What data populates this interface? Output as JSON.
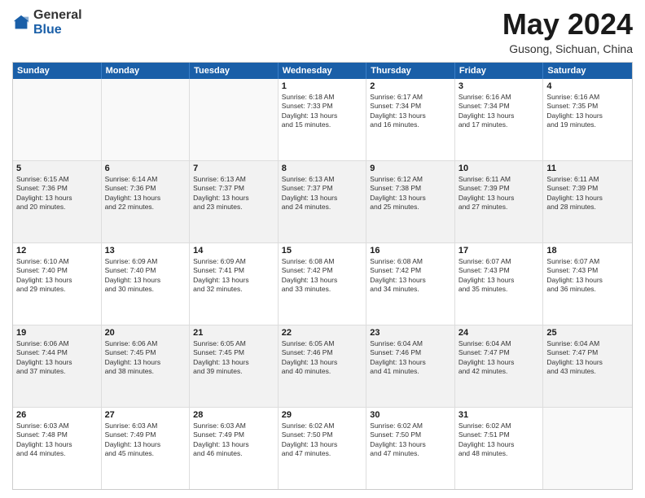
{
  "logo": {
    "text_general": "General",
    "text_blue": "Blue"
  },
  "title": "May 2024",
  "subtitle": "Gusong, Sichuan, China",
  "days_of_week": [
    "Sunday",
    "Monday",
    "Tuesday",
    "Wednesday",
    "Thursday",
    "Friday",
    "Saturday"
  ],
  "rows": [
    {
      "alt": false,
      "cells": [
        {
          "day": "",
          "info": ""
        },
        {
          "day": "",
          "info": ""
        },
        {
          "day": "",
          "info": ""
        },
        {
          "day": "1",
          "info": "Sunrise: 6:18 AM\nSunset: 7:33 PM\nDaylight: 13 hours\nand 15 minutes."
        },
        {
          "day": "2",
          "info": "Sunrise: 6:17 AM\nSunset: 7:34 PM\nDaylight: 13 hours\nand 16 minutes."
        },
        {
          "day": "3",
          "info": "Sunrise: 6:16 AM\nSunset: 7:34 PM\nDaylight: 13 hours\nand 17 minutes."
        },
        {
          "day": "4",
          "info": "Sunrise: 6:16 AM\nSunset: 7:35 PM\nDaylight: 13 hours\nand 19 minutes."
        }
      ]
    },
    {
      "alt": true,
      "cells": [
        {
          "day": "5",
          "info": "Sunrise: 6:15 AM\nSunset: 7:36 PM\nDaylight: 13 hours\nand 20 minutes."
        },
        {
          "day": "6",
          "info": "Sunrise: 6:14 AM\nSunset: 7:36 PM\nDaylight: 13 hours\nand 22 minutes."
        },
        {
          "day": "7",
          "info": "Sunrise: 6:13 AM\nSunset: 7:37 PM\nDaylight: 13 hours\nand 23 minutes."
        },
        {
          "day": "8",
          "info": "Sunrise: 6:13 AM\nSunset: 7:37 PM\nDaylight: 13 hours\nand 24 minutes."
        },
        {
          "day": "9",
          "info": "Sunrise: 6:12 AM\nSunset: 7:38 PM\nDaylight: 13 hours\nand 25 minutes."
        },
        {
          "day": "10",
          "info": "Sunrise: 6:11 AM\nSunset: 7:39 PM\nDaylight: 13 hours\nand 27 minutes."
        },
        {
          "day": "11",
          "info": "Sunrise: 6:11 AM\nSunset: 7:39 PM\nDaylight: 13 hours\nand 28 minutes."
        }
      ]
    },
    {
      "alt": false,
      "cells": [
        {
          "day": "12",
          "info": "Sunrise: 6:10 AM\nSunset: 7:40 PM\nDaylight: 13 hours\nand 29 minutes."
        },
        {
          "day": "13",
          "info": "Sunrise: 6:09 AM\nSunset: 7:40 PM\nDaylight: 13 hours\nand 30 minutes."
        },
        {
          "day": "14",
          "info": "Sunrise: 6:09 AM\nSunset: 7:41 PM\nDaylight: 13 hours\nand 32 minutes."
        },
        {
          "day": "15",
          "info": "Sunrise: 6:08 AM\nSunset: 7:42 PM\nDaylight: 13 hours\nand 33 minutes."
        },
        {
          "day": "16",
          "info": "Sunrise: 6:08 AM\nSunset: 7:42 PM\nDaylight: 13 hours\nand 34 minutes."
        },
        {
          "day": "17",
          "info": "Sunrise: 6:07 AM\nSunset: 7:43 PM\nDaylight: 13 hours\nand 35 minutes."
        },
        {
          "day": "18",
          "info": "Sunrise: 6:07 AM\nSunset: 7:43 PM\nDaylight: 13 hours\nand 36 minutes."
        }
      ]
    },
    {
      "alt": true,
      "cells": [
        {
          "day": "19",
          "info": "Sunrise: 6:06 AM\nSunset: 7:44 PM\nDaylight: 13 hours\nand 37 minutes."
        },
        {
          "day": "20",
          "info": "Sunrise: 6:06 AM\nSunset: 7:45 PM\nDaylight: 13 hours\nand 38 minutes."
        },
        {
          "day": "21",
          "info": "Sunrise: 6:05 AM\nSunset: 7:45 PM\nDaylight: 13 hours\nand 39 minutes."
        },
        {
          "day": "22",
          "info": "Sunrise: 6:05 AM\nSunset: 7:46 PM\nDaylight: 13 hours\nand 40 minutes."
        },
        {
          "day": "23",
          "info": "Sunrise: 6:04 AM\nSunset: 7:46 PM\nDaylight: 13 hours\nand 41 minutes."
        },
        {
          "day": "24",
          "info": "Sunrise: 6:04 AM\nSunset: 7:47 PM\nDaylight: 13 hours\nand 42 minutes."
        },
        {
          "day": "25",
          "info": "Sunrise: 6:04 AM\nSunset: 7:47 PM\nDaylight: 13 hours\nand 43 minutes."
        }
      ]
    },
    {
      "alt": false,
      "cells": [
        {
          "day": "26",
          "info": "Sunrise: 6:03 AM\nSunset: 7:48 PM\nDaylight: 13 hours\nand 44 minutes."
        },
        {
          "day": "27",
          "info": "Sunrise: 6:03 AM\nSunset: 7:49 PM\nDaylight: 13 hours\nand 45 minutes."
        },
        {
          "day": "28",
          "info": "Sunrise: 6:03 AM\nSunset: 7:49 PM\nDaylight: 13 hours\nand 46 minutes."
        },
        {
          "day": "29",
          "info": "Sunrise: 6:02 AM\nSunset: 7:50 PM\nDaylight: 13 hours\nand 47 minutes."
        },
        {
          "day": "30",
          "info": "Sunrise: 6:02 AM\nSunset: 7:50 PM\nDaylight: 13 hours\nand 47 minutes."
        },
        {
          "day": "31",
          "info": "Sunrise: 6:02 AM\nSunset: 7:51 PM\nDaylight: 13 hours\nand 48 minutes."
        },
        {
          "day": "",
          "info": ""
        }
      ]
    }
  ]
}
